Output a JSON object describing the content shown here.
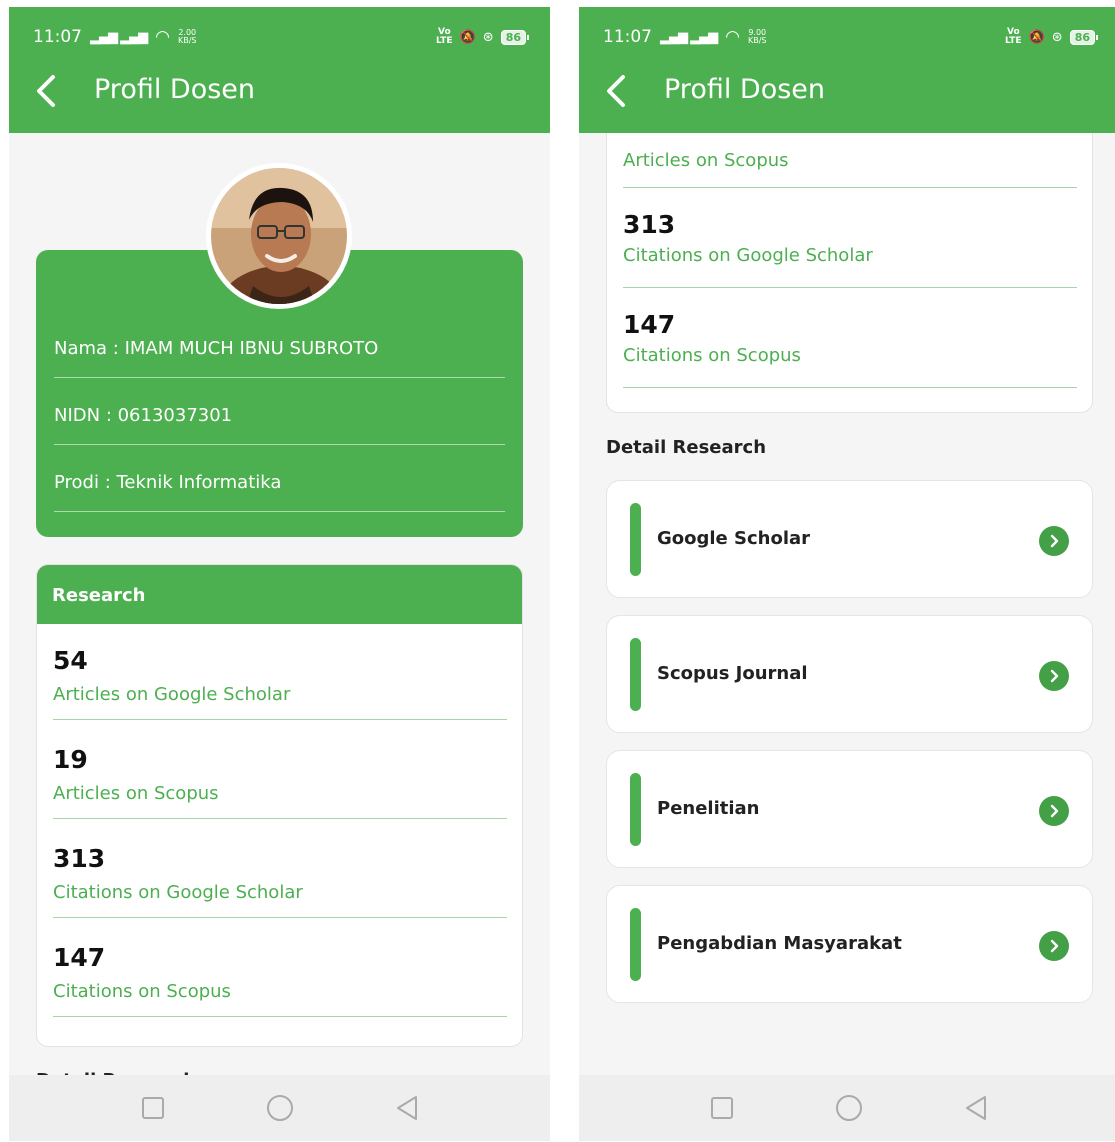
{
  "status_left": {
    "time": "11:07",
    "net_speed": "2.00",
    "net_unit": "KB/S"
  },
  "status_right": {
    "time": "11:07",
    "net_speed": "9.00",
    "net_unit": "KB/S"
  },
  "status_common": {
    "volte_top": "Vo",
    "volte_bottom": "LTE",
    "battery": "86"
  },
  "appbar": {
    "title": "Profil Dosen"
  },
  "profile": {
    "name": "Nama : IMAM MUCH IBNU SUBROTO",
    "nidn": "NIDN : 0613037301",
    "prodi": "Prodi : Teknik Informatika"
  },
  "research": {
    "header": "Research",
    "stats": [
      {
        "value": "54",
        "label": "Articles on Google Scholar"
      },
      {
        "value": "19",
        "label": "Articles on Scopus"
      },
      {
        "value": "313",
        "label": "Citations on Google Scholar"
      },
      {
        "value": "147",
        "label": "Citations on Scopus"
      }
    ]
  },
  "detail_research": {
    "title": "Detail Research",
    "items": [
      {
        "label": "Google Scholar"
      },
      {
        "label": "Scopus Journal"
      },
      {
        "label": "Penelitian"
      },
      {
        "label": "Pengabdian Masyarakat"
      }
    ]
  },
  "colors": {
    "primary": "#4caf50",
    "arrow_button": "#43a047",
    "divider": "#a5d6a7"
  },
  "icons": {
    "back": "chevron-left-icon",
    "nav_recent": "square-icon",
    "nav_home": "circle-icon",
    "nav_back": "triangle-back-icon",
    "detail_arrow": "chevron-right-circle-icon"
  }
}
